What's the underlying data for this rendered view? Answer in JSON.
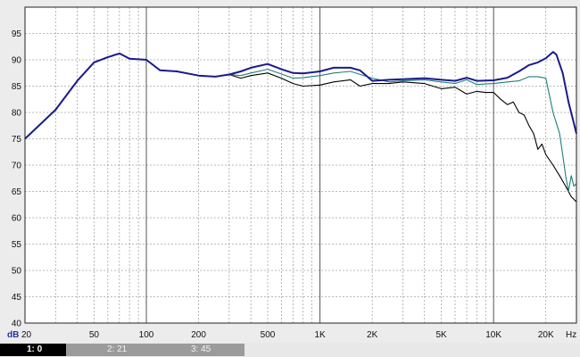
{
  "chart_data": {
    "type": "line",
    "x_scale": "log",
    "xlim": [
      20,
      30000
    ],
    "ylim": [
      40,
      100
    ],
    "y_unit": "dB",
    "x_unit": "Hz",
    "y_ticks": [
      40,
      45,
      50,
      55,
      60,
      65,
      70,
      75,
      80,
      85,
      90,
      95
    ],
    "x_ticks": [
      {
        "value": 20,
        "label": "20"
      },
      {
        "value": 50,
        "label": "50"
      },
      {
        "value": 100,
        "label": "100"
      },
      {
        "value": 200,
        "label": "200"
      },
      {
        "value": 500,
        "label": "500"
      },
      {
        "value": 1000,
        "label": "1K"
      },
      {
        "value": 2000,
        "label": "2K"
      },
      {
        "value": 5000,
        "label": "5K"
      },
      {
        "value": 10000,
        "label": "10K"
      },
      {
        "value": 20000,
        "label": "20K"
      }
    ],
    "grid": true,
    "series": [
      {
        "color": "#000000",
        "points": [
          [
            20,
            75
          ],
          [
            30,
            80.5
          ],
          [
            40,
            86
          ],
          [
            50,
            89.5
          ],
          [
            60,
            90.5
          ],
          [
            70,
            91.2
          ],
          [
            80,
            90.2
          ],
          [
            100,
            90
          ],
          [
            120,
            88
          ],
          [
            150,
            87.8
          ],
          [
            200,
            87
          ],
          [
            250,
            86.8
          ],
          [
            300,
            87.2
          ],
          [
            350,
            86.5
          ],
          [
            400,
            87
          ],
          [
            500,
            87.5
          ],
          [
            600,
            86.5
          ],
          [
            700,
            85.5
          ],
          [
            800,
            85
          ],
          [
            1000,
            85.2
          ],
          [
            1200,
            85.8
          ],
          [
            1500,
            86.2
          ],
          [
            1700,
            85
          ],
          [
            2000,
            85.5
          ],
          [
            2500,
            85.5
          ],
          [
            3000,
            85.8
          ],
          [
            4000,
            85.5
          ],
          [
            5000,
            84.5
          ],
          [
            6000,
            84.8
          ],
          [
            7000,
            83.5
          ],
          [
            8000,
            84
          ],
          [
            9000,
            83.8
          ],
          [
            10000,
            83.8
          ],
          [
            11000,
            82.5
          ],
          [
            12000,
            81.5
          ],
          [
            13000,
            82
          ],
          [
            14000,
            80
          ],
          [
            15000,
            79.5
          ],
          [
            16000,
            77.5
          ],
          [
            17000,
            76
          ],
          [
            18000,
            73
          ],
          [
            19000,
            74
          ],
          [
            20000,
            72
          ],
          [
            22000,
            70
          ],
          [
            24000,
            68
          ],
          [
            26000,
            66
          ],
          [
            28000,
            64
          ],
          [
            30000,
            63
          ]
        ]
      },
      {
        "color": "#1f7e7a",
        "points": [
          [
            20,
            75
          ],
          [
            30,
            80.5
          ],
          [
            40,
            86
          ],
          [
            50,
            89.5
          ],
          [
            60,
            90.5
          ],
          [
            70,
            91.2
          ],
          [
            80,
            90.2
          ],
          [
            100,
            90
          ],
          [
            120,
            88
          ],
          [
            150,
            87.8
          ],
          [
            200,
            87
          ],
          [
            250,
            86.8
          ],
          [
            300,
            87.2
          ],
          [
            350,
            87
          ],
          [
            400,
            87.5
          ],
          [
            500,
            88.2
          ],
          [
            600,
            87.3
          ],
          [
            700,
            86.5
          ],
          [
            800,
            86.6
          ],
          [
            1000,
            87
          ],
          [
            1200,
            87.5
          ],
          [
            1500,
            87.8
          ],
          [
            2000,
            86.5
          ],
          [
            2500,
            85.8
          ],
          [
            3000,
            86
          ],
          [
            4000,
            86.2
          ],
          [
            5000,
            85.8
          ],
          [
            6000,
            85.5
          ],
          [
            7000,
            86.2
          ],
          [
            8000,
            85.3
          ],
          [
            10000,
            85.5
          ],
          [
            12000,
            85.8
          ],
          [
            14000,
            86
          ],
          [
            16000,
            86.8
          ],
          [
            18000,
            86.8
          ],
          [
            20000,
            86.5
          ],
          [
            22000,
            80
          ],
          [
            24000,
            76
          ],
          [
            25000,
            72
          ],
          [
            26000,
            68
          ],
          [
            27000,
            65
          ],
          [
            28000,
            68
          ],
          [
            29000,
            66
          ],
          [
            30000,
            66.5
          ]
        ]
      },
      {
        "color": "#1a1a8c",
        "points": [
          [
            20,
            75
          ],
          [
            30,
            80.5
          ],
          [
            40,
            86
          ],
          [
            50,
            89.5
          ],
          [
            60,
            90.5
          ],
          [
            70,
            91.2
          ],
          [
            80,
            90.2
          ],
          [
            100,
            90
          ],
          [
            120,
            88
          ],
          [
            150,
            87.8
          ],
          [
            200,
            87
          ],
          [
            250,
            86.8
          ],
          [
            300,
            87.2
          ],
          [
            350,
            87.8
          ],
          [
            400,
            88.5
          ],
          [
            500,
            89.2
          ],
          [
            600,
            88.2
          ],
          [
            700,
            87.5
          ],
          [
            800,
            87.4
          ],
          [
            1000,
            87.8
          ],
          [
            1200,
            88.5
          ],
          [
            1500,
            88.5
          ],
          [
            1700,
            88
          ],
          [
            2000,
            86
          ],
          [
            2500,
            86.2
          ],
          [
            3000,
            86.3
          ],
          [
            4000,
            86.5
          ],
          [
            5000,
            86.2
          ],
          [
            6000,
            86
          ],
          [
            7000,
            86.6
          ],
          [
            8000,
            86
          ],
          [
            10000,
            86.1
          ],
          [
            12000,
            86.6
          ],
          [
            14000,
            87.8
          ],
          [
            16000,
            89
          ],
          [
            18000,
            89.5
          ],
          [
            20000,
            90.3
          ],
          [
            22000,
            91.5
          ],
          [
            23000,
            91
          ],
          [
            25000,
            87.5
          ],
          [
            27000,
            82
          ],
          [
            30000,
            76
          ]
        ]
      }
    ]
  },
  "tabs": [
    {
      "label": "1: 0",
      "color": "#000000"
    },
    {
      "label": "2: 21",
      "color": "#9b9b9b"
    },
    {
      "label": "3: 45",
      "color": "#9b9b9b"
    }
  ]
}
